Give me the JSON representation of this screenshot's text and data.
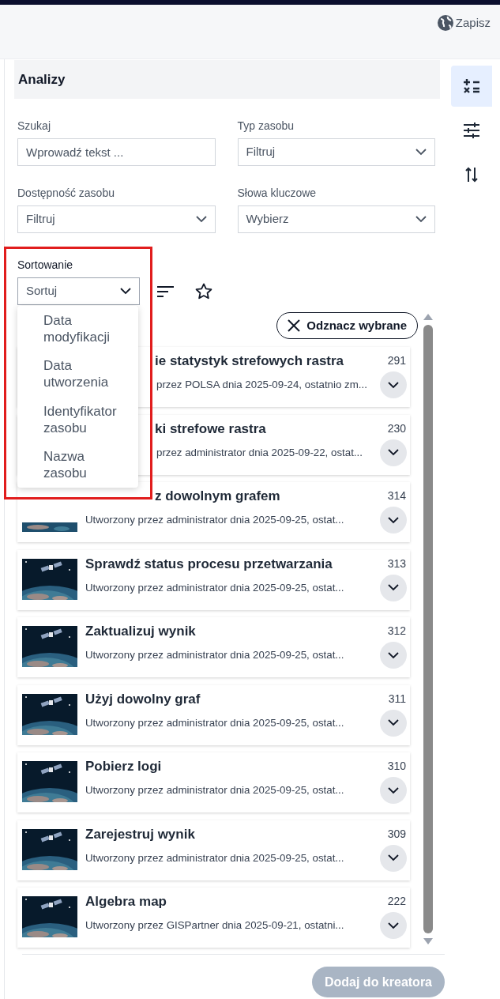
{
  "header": {
    "save_label": "Zapisz"
  },
  "panel": {
    "title": "Analizy",
    "fields": [
      {
        "label": "Szukaj",
        "kind": "text",
        "placeholder": "Wprowadź tekst ..."
      },
      {
        "label": "Typ zasobu",
        "kind": "select",
        "value": "Filtruj"
      },
      {
        "label": "Dostępność zasobu",
        "kind": "select",
        "value": "Filtruj"
      },
      {
        "label": "Słowa kluczowe",
        "kind": "select",
        "value": "Wybierz"
      }
    ],
    "sort": {
      "label": "Sortowanie",
      "value": "Sortuj",
      "expanded": true,
      "options": [
        {
          "label": "Data modyfikacji"
        },
        {
          "label": "Data utworzenia"
        },
        {
          "label": "Identyfikator zasobu"
        },
        {
          "label": "Nazwa zasobu"
        }
      ]
    },
    "clear_button": "Odznacz wybrane",
    "cards": [
      {
        "kind": "both_cut",
        "title": "ie statystyk strefowych rastra",
        "number": "291",
        "subtitle": "przez POLSA dnia 2025-09-24, ostatnio zm..."
      },
      {
        "kind": "both_cut",
        "title": "ki strefowe rastra",
        "number": "230",
        "subtitle": "przez administrator dnia 2025-09-22, ostat..."
      },
      {
        "kind": "title_cut",
        "title": "z dowolnym grafem",
        "number": "314",
        "subtitle": "Utworzony przez administrator dnia 2025-09-25, ostat..."
      },
      {
        "kind": "full",
        "title": "Sprawdź status procesu przetwarzania",
        "number": "313",
        "subtitle": "Utworzony przez administrator dnia 2025-09-25, ostat..."
      },
      {
        "kind": "full",
        "title": "Zaktualizuj wynik",
        "number": "312",
        "subtitle": "Utworzony przez administrator dnia 2025-09-25, ostat..."
      },
      {
        "kind": "full",
        "title": "Użyj dowolny graf",
        "number": "311",
        "subtitle": "Utworzony przez administrator dnia 2025-09-25, ostat..."
      },
      {
        "kind": "full",
        "title": "Pobierz logi",
        "number": "310",
        "subtitle": "Utworzony przez administrator dnia 2025-09-25, ostat..."
      },
      {
        "kind": "full",
        "title": "Zarejestruj wynik",
        "number": "309",
        "subtitle": "Utworzony przez administrator dnia 2025-09-25, ostat..."
      },
      {
        "kind": "full",
        "title": "Algebra map",
        "number": "222",
        "subtitle": "Utworzony przez GISPartner dnia 2025-09-21, ostatni..."
      }
    ],
    "add_button": {
      "label": "Dodaj do kreatora",
      "disabled": true
    }
  },
  "rail": [
    {
      "kind": "calc",
      "selected": true
    },
    {
      "kind": "sliders",
      "selected": false
    },
    {
      "kind": "swap",
      "selected": false
    }
  ]
}
